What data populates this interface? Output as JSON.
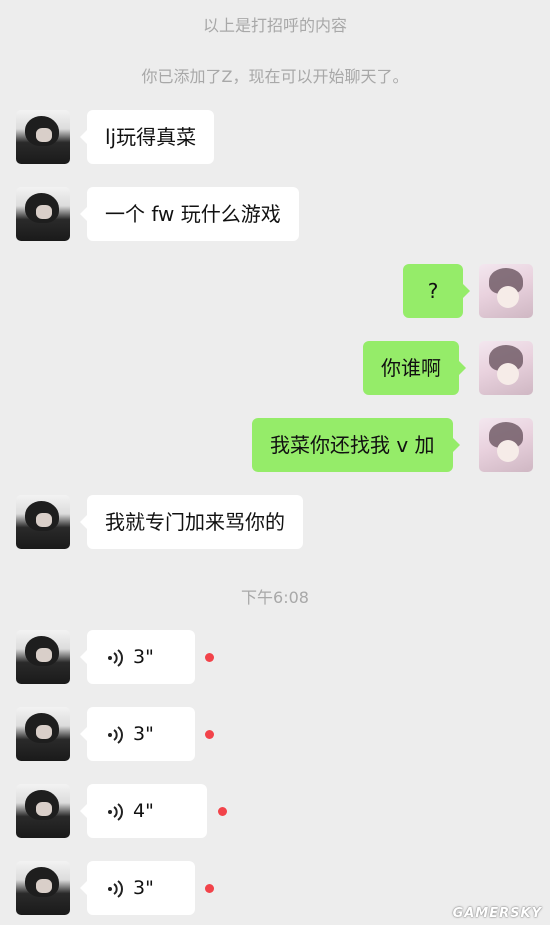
{
  "system": {
    "greeting_note": "以上是打招呼的内容",
    "added_note": "你已添加了Z，现在可以开始聊天了。",
    "timestamp": "下午6:08"
  },
  "messages": [
    {
      "from": "peer",
      "text": "lj玩得真菜"
    },
    {
      "from": "peer",
      "text": "一个 fw 玩什么游戏"
    },
    {
      "from": "self",
      "text": "?"
    },
    {
      "from": "self",
      "text": "你谁啊"
    },
    {
      "from": "self",
      "text": "我菜你还找我 v 加"
    },
    {
      "from": "peer",
      "text": "我就专门加来骂你的"
    }
  ],
  "voice_messages": [
    {
      "duration": "3\"",
      "unread": true
    },
    {
      "duration": "3\"",
      "unread": true
    },
    {
      "duration": "4\"",
      "unread": true
    },
    {
      "duration": "3\"",
      "unread": true
    }
  ],
  "colors": {
    "background": "#ededed",
    "outgoing_bubble": "#95ec69",
    "incoming_bubble": "#ffffff",
    "unread_dot": "#f2434a"
  },
  "icons": {
    "voice": "voice-wave-icon"
  },
  "watermark": "GAMERSKY"
}
